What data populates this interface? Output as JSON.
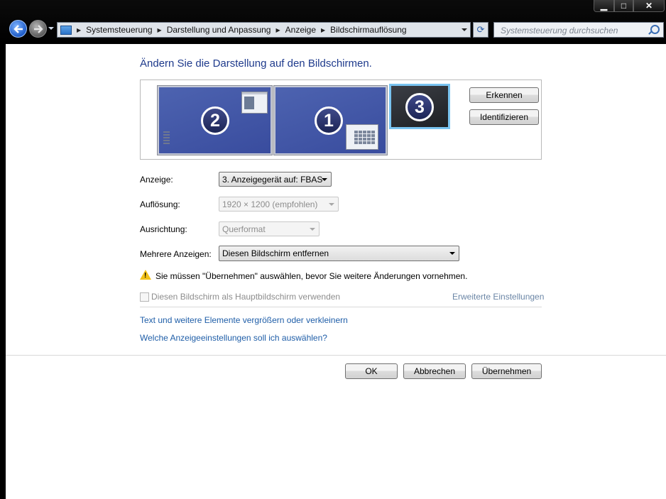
{
  "window": {
    "minimize_glyph": "▁",
    "maximize_glyph": "□",
    "close_glyph": "✕"
  },
  "navigation": {
    "back_icon": "arrow-left-icon",
    "forward_icon": "arrow-right-icon",
    "breadcrumbs": [
      "Systemsteuerung",
      "Darstellung und Anpassung",
      "Anzeige",
      "Bildschirmauflösung"
    ],
    "breadcrumb_separator": "▶",
    "refresh_glyph": "⟳",
    "search_placeholder": "Systemsteuerung durchsuchen"
  },
  "main": {
    "title": "Ändern Sie die Darstellung auf den Bildschirmen.",
    "monitors": [
      {
        "number": "2",
        "selected": false
      },
      {
        "number": "1",
        "selected": false
      },
      {
        "number": "3",
        "selected": true
      }
    ],
    "detect_button": "Erkennen",
    "identify_button": "Identifizieren",
    "display_label": "Anzeige:",
    "display_value": "3. Anzeigegerät auf: FBAS",
    "resolution_label": "Auflösung:",
    "resolution_value": "1920 × 1200 (empfohlen)",
    "orientation_label": "Ausrichtung:",
    "orientation_value": "Querformat",
    "multiple_label": "Mehrere Anzeigen:",
    "multiple_value": "Diesen Bildschirm entfernen",
    "warning_text": "Sie müssen \"Übernehmen\" auswählen, bevor Sie weitere Änderungen vornehmen.",
    "primary_checkbox_label": "Diesen Bildschirm als Hauptbildschirm verwenden",
    "advanced_link": "Erweiterte Einstellungen",
    "link_text_size": "Text und weitere Elemente vergrößern oder verkleinern",
    "link_which_settings": "Welche Anzeigeeinstellungen soll ich auswählen?"
  },
  "footer": {
    "ok": "OK",
    "cancel": "Abbrechen",
    "apply": "Übernehmen"
  },
  "colors": {
    "title_blue": "#1e3a8c",
    "link_blue": "#1f5ea8",
    "monitor_blue": "#4458a8",
    "selected_border": "#79c3f0",
    "warning_yellow": "#f2c21a"
  }
}
